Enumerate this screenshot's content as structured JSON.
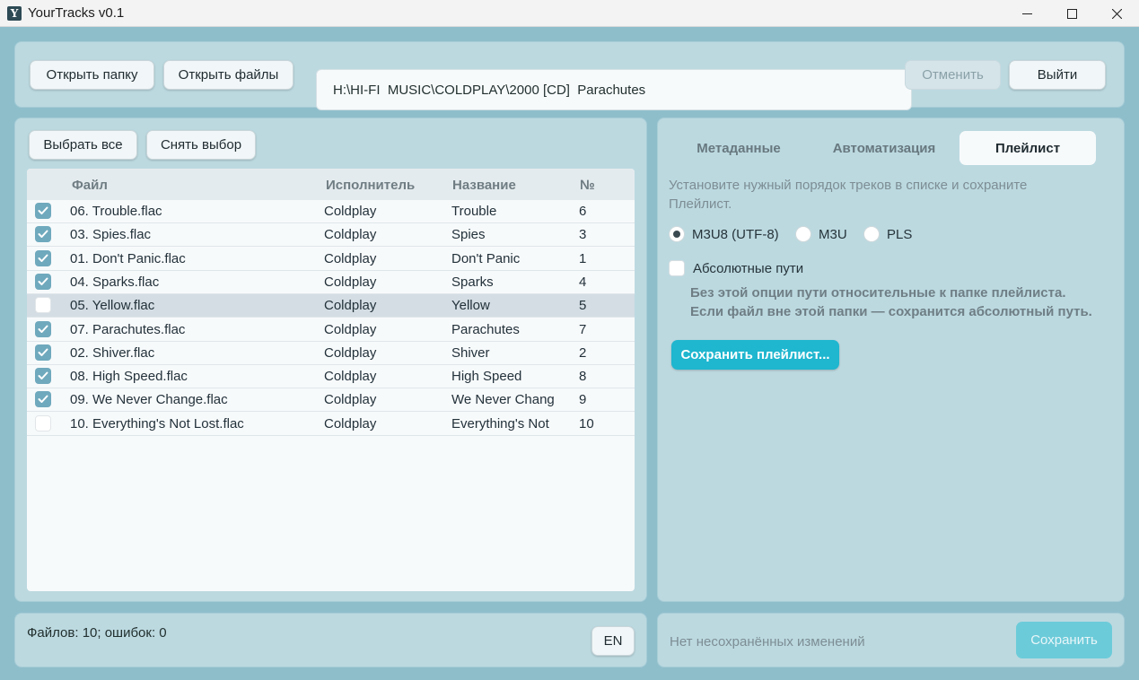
{
  "window": {
    "title": "YourTracks v0.1",
    "icon_letter": "Y"
  },
  "toolbar": {
    "open_folder": "Открыть папку",
    "open_files": "Открыть файлы",
    "path": "H:\\HI-FI  MUSIC\\COLDPLAY\\2000 [CD]  Parachutes",
    "cancel": "Отменить",
    "exit": "Выйти"
  },
  "selection": {
    "select_all": "Выбрать все",
    "deselect": "Снять выбор"
  },
  "table": {
    "columns": [
      "Файл",
      "Исполнитель",
      "Название",
      "№"
    ],
    "rows": [
      {
        "checked": true,
        "file": "06. Trouble.flac",
        "artist": "Coldplay",
        "title": "Trouble",
        "num": "6"
      },
      {
        "checked": true,
        "file": "03. Spies.flac",
        "artist": "Coldplay",
        "title": "Spies",
        "num": "3"
      },
      {
        "checked": true,
        "file": "01. Don't Panic.flac",
        "artist": "Coldplay",
        "title": "Don't Panic",
        "num": "1"
      },
      {
        "checked": true,
        "file": "04. Sparks.flac",
        "artist": "Coldplay",
        "title": "Sparks",
        "num": "4"
      },
      {
        "checked": false,
        "selected": true,
        "file": "05. Yellow.flac",
        "artist": "Coldplay",
        "title": "Yellow",
        "num": "5"
      },
      {
        "checked": true,
        "file": "07. Parachutes.flac",
        "artist": "Coldplay",
        "title": "Parachutes",
        "num": "7"
      },
      {
        "checked": true,
        "file": "02. Shiver.flac",
        "artist": "Coldplay",
        "title": "Shiver",
        "num": "2"
      },
      {
        "checked": true,
        "file": "08. High Speed.flac",
        "artist": "Coldplay",
        "title": "High Speed",
        "num": "8"
      },
      {
        "checked": true,
        "file": "09. We Never Change.flac",
        "artist": "Coldplay",
        "title": "We Never Chang",
        "num": "9"
      },
      {
        "checked": false,
        "file": "10. Everything's Not Lost.flac",
        "artist": "Coldplay",
        "title": "Everything's Not",
        "num": "10"
      }
    ]
  },
  "tabs": [
    {
      "label": "Метаданные",
      "active": false
    },
    {
      "label": "Автоматизация",
      "active": false
    },
    {
      "label": "Плейлист",
      "active": true
    }
  ],
  "playlist": {
    "hint": "Установите нужный порядок треков в списке и сохраните Плейлист.",
    "formats": [
      {
        "label": "M3U8 (UTF-8)",
        "selected": true
      },
      {
        "label": "M3U",
        "selected": false
      },
      {
        "label": "PLS",
        "selected": false
      }
    ],
    "absolute_paths_label": "Абсолютные пути",
    "absolute_paths_checked": false,
    "note_line1": "Без этой опции пути относительные к папке плейлиста.",
    "note_line2": "Если файл вне этой папки — сохранится абсолютный путь.",
    "save_playlist": "Сохранить плейлист..."
  },
  "status": {
    "files_info": "Файлов: 10; ошибок: 0",
    "language": "EN",
    "unsaved": "Нет несохранённых изменений",
    "save": "Сохранить"
  },
  "colors": {
    "accent": "#1fb6cf",
    "checkbox_checked": "#6fa9bd",
    "background": "#8fbecb",
    "panel": "#bcd9e0"
  }
}
